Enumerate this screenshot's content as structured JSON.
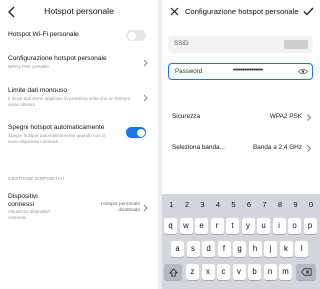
{
  "left": {
    "header": {
      "title": "Hotspot personale"
    },
    "items": [
      {
        "title": "Hotspot Wi-Fi personale",
        "toggle": "off"
      },
      {
        "title": "Configurazione hotspot personale",
        "subtitle": "WPA2 PSK portatile"
      },
      {
        "title": "Limite dati monouso",
        "subtitle": "Il limite dati viene applicato la prossima volta che un hotspot viene attivato"
      },
      {
        "title": "Spegni hotspot automaticamente",
        "subtitle": "Spegni hotspot automaticamente quando non ci sono dispositivi connessi",
        "toggle": "on"
      }
    ],
    "section_title": "GESTIONE DISPOSITIVI",
    "devices": {
      "title": "Dispositivi connessi",
      "subtitle": "Visualizza dispositivi connessi",
      "value": "Hotspot personale disattivato"
    }
  },
  "right": {
    "header": {
      "title": "Configurazione hotspot personale"
    },
    "ssid_label": "SSID",
    "password_label": "Password",
    "password_dots": "••••••••••••••••",
    "security": {
      "label": "Sicurezza",
      "value": "WPA2 PSK"
    },
    "band": {
      "label": "Seleziona banda...",
      "value": "Banda a 2,4 GHz"
    }
  },
  "keyboard": {
    "numbers": [
      "1",
      "2",
      "3",
      "4",
      "5",
      "6",
      "7",
      "8",
      "9",
      "0"
    ],
    "row1": [
      "q",
      "w",
      "e",
      "r",
      "t",
      "y",
      "u",
      "i",
      "o",
      "p"
    ],
    "row2": [
      "a",
      "s",
      "d",
      "f",
      "g",
      "h",
      "j",
      "k",
      "l"
    ],
    "row3": [
      "z",
      "x",
      "c",
      "v",
      "b",
      "n",
      "m"
    ]
  },
  "colors": {
    "accent": "#1a73e8",
    "keyboard_bg": "#d4d6dd"
  }
}
